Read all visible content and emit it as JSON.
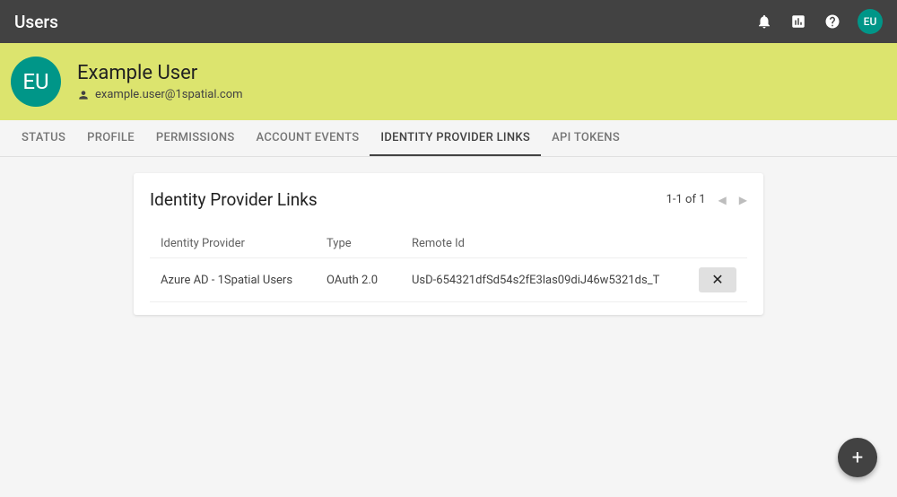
{
  "topbar": {
    "title": "Users",
    "avatar_initials": "EU"
  },
  "header": {
    "avatar_initials": "EU",
    "user_name": "Example User",
    "user_email": "example.user@1spatial.com"
  },
  "tabs": [
    {
      "label": "STATUS",
      "active": false
    },
    {
      "label": "PROFILE",
      "active": false
    },
    {
      "label": "PERMISSIONS",
      "active": false
    },
    {
      "label": "ACCOUNT EVENTS",
      "active": false
    },
    {
      "label": "IDENTITY PROVIDER LINKS",
      "active": true
    },
    {
      "label": "API TOKENS",
      "active": false
    }
  ],
  "card": {
    "title": "Identity Provider Links",
    "pager_text": "1-1 of 1",
    "columns": {
      "provider": "Identity Provider",
      "type": "Type",
      "remote": "Remote Id"
    },
    "rows": [
      {
        "provider": "Azure AD - 1Spatial Users",
        "type": "OAuth 2.0",
        "remote": "UsD-654321dfSd54s2fE3las09diJ46w5321ds_T"
      }
    ]
  },
  "fab": {
    "symbol": "+"
  }
}
